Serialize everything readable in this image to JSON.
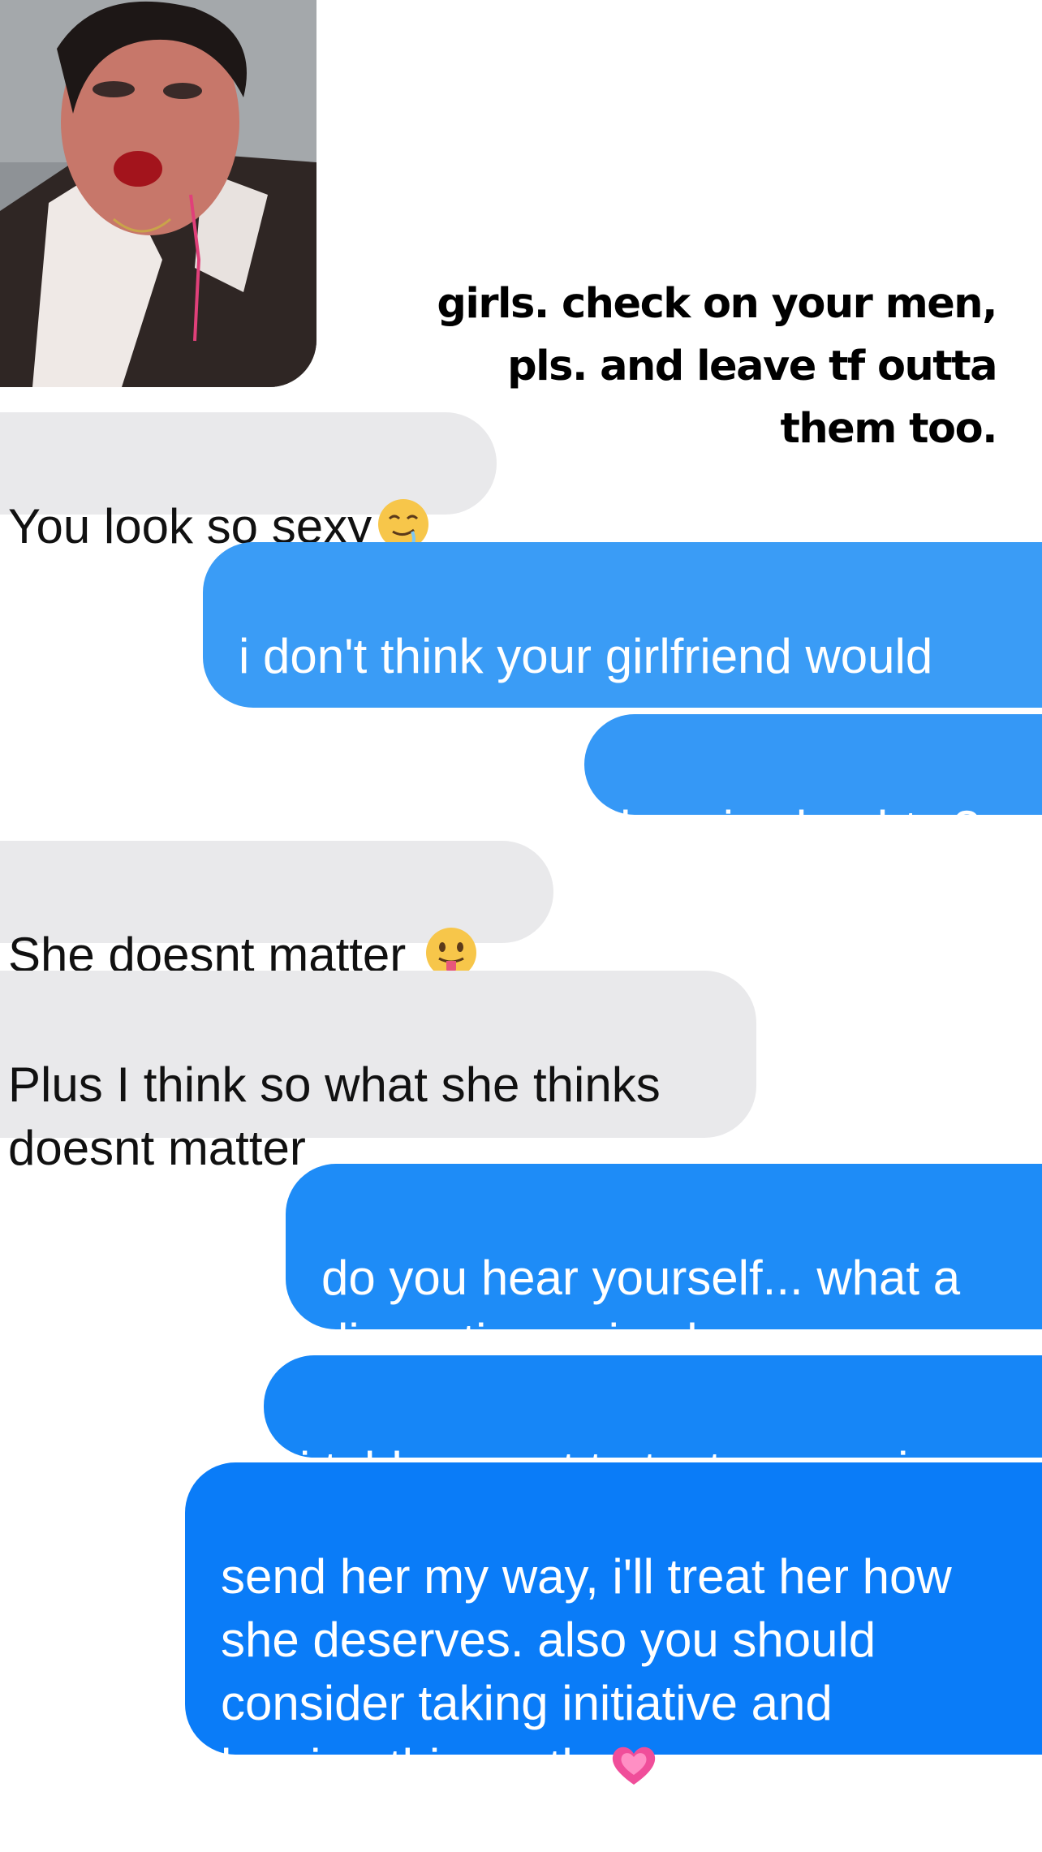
{
  "caption": {
    "line1": "girls. check on your men,",
    "line2": "pls. and leave tf outta",
    "line3": "them too."
  },
  "messages": [
    {
      "side": "received",
      "text": "You look so sexy",
      "emoji": "drooling-face-icon"
    },
    {
      "side": "sent",
      "text": "i don't think your girlfriend would\nagree."
    },
    {
      "side": "sent",
      "text": "how is she, btw?"
    },
    {
      "side": "received",
      "text": "She doesnt matter ",
      "emoji": "tongue-face-icon"
    },
    {
      "side": "received",
      "text": "Plus I think so what she thinks\ndoesnt matter"
    },
    {
      "side": "sent",
      "text": "do you hear yourself... what a\ndisgusting animal you are."
    },
    {
      "side": "sent",
      "text": "i told you not to text me again."
    },
    {
      "side": "sent",
      "text": "send her my way, i'll treat her how\nshe deserves. also you should\nconsider taking initiative and\nleaving this earth ",
      "emoji": "growing-heart-icon"
    }
  ],
  "colors": {
    "received_bubble": "#e9e9eb",
    "sent_bubble_light": "#3a9cf6",
    "sent_bubble_dark": "#0a7cf8"
  }
}
